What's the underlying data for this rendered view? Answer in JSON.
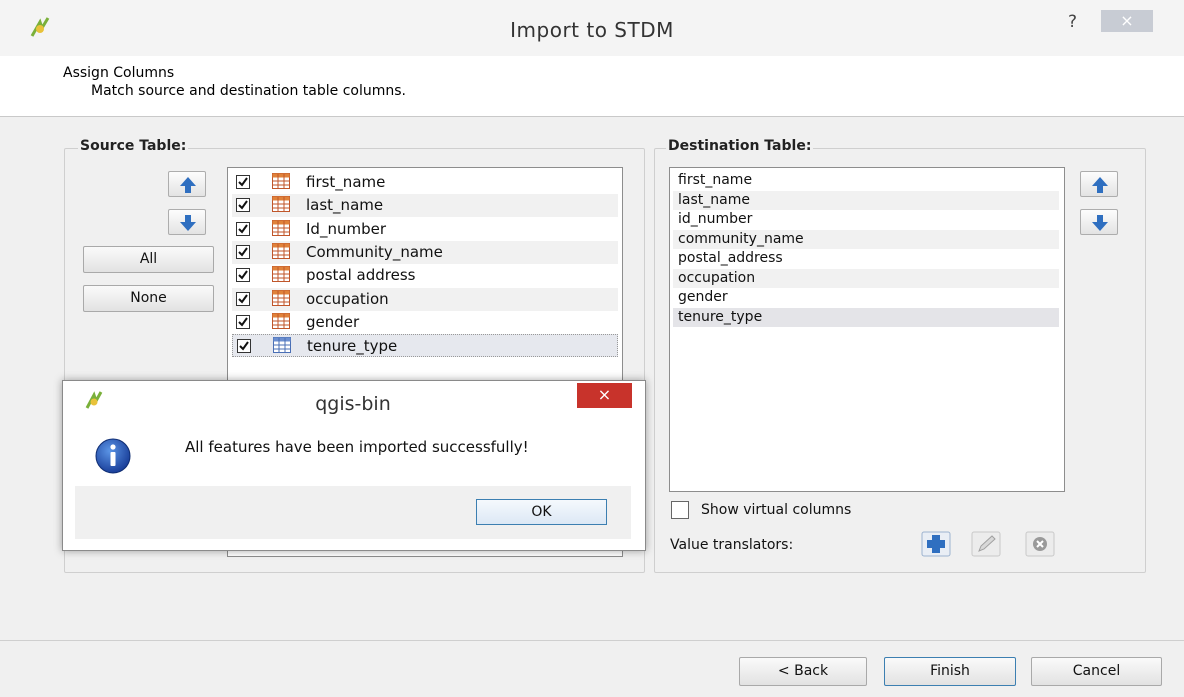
{
  "window": {
    "title": "Import to STDM",
    "help_label": "?",
    "close_label": "×"
  },
  "header": {
    "title": "Assign Columns",
    "subtitle": "Match source and destination table columns."
  },
  "source": {
    "group_title": "Source Table:",
    "all_label": "All",
    "none_label": "None",
    "columns": [
      {
        "label": "first_name",
        "checked": true
      },
      {
        "label": "last_name",
        "checked": true
      },
      {
        "label": "Id_number",
        "checked": true
      },
      {
        "label": "Community_name",
        "checked": true
      },
      {
        "label": "postal address",
        "checked": true
      },
      {
        "label": "occupation",
        "checked": true
      },
      {
        "label": "gender",
        "checked": true
      },
      {
        "label": "tenure_type",
        "checked": true,
        "selected": true
      }
    ]
  },
  "destination": {
    "group_title": "Destination Table:",
    "columns": [
      "first_name",
      "last_name",
      "id_number",
      "community_name",
      "postal_address",
      "occupation",
      "gender",
      "tenure_type"
    ],
    "selected": "tenure_type",
    "show_virtual_label": "Show virtual columns",
    "show_virtual_checked": false,
    "value_translators_label": "Value translators:"
  },
  "footer": {
    "back_label": "< Back",
    "finish_label": "Finish",
    "cancel_label": "Cancel"
  },
  "message_box": {
    "title": "qgis-bin",
    "message": "All features have been imported successfully!",
    "ok_label": "OK",
    "close_label": "×"
  },
  "colors": {
    "accent_blue": "#2f6fc0",
    "close_red": "#c8332b",
    "ok_border": "#3c7fb1"
  }
}
